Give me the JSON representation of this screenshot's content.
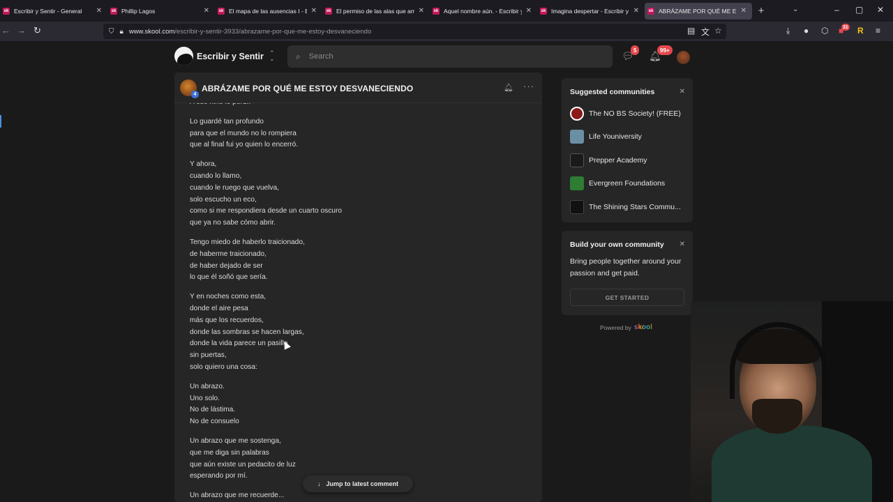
{
  "browser": {
    "tabs": [
      {
        "favicon": "sk",
        "title": "Escribir y Sentir - General",
        "active": false
      },
      {
        "favicon": "sk",
        "title": "Phillip Lagos",
        "active": false
      },
      {
        "favicon": "sk",
        "title": "El mapa de las ausencias I - Esc",
        "active": false
      },
      {
        "favicon": "sk",
        "title": "El permiso de las alas que amé",
        "active": false
      },
      {
        "favicon": "sk",
        "title": "Aquel nombre aún. - Escribir y S",
        "active": false
      },
      {
        "favicon": "sk",
        "title": "Imagina despertar - Escribir y S",
        "active": false
      },
      {
        "favicon": "sk",
        "title": "ABRÁZAME POR QUÉ ME ESTO",
        "active": true
      }
    ],
    "new_tab": "+",
    "url_host": "www.skool.com",
    "url_path": "/escribir-y-sentir-3933/abrazame-por-que-me-estoy-desvaneciendo",
    "extension_badge": "31"
  },
  "app": {
    "community_name": "Escribir y Sentir",
    "search_placeholder": "Search",
    "chat_badge": "5",
    "notif_badge": "99+"
  },
  "post": {
    "author_level": "4",
    "title": "ABRÁZAME POR QUÉ ME ESTOY DESVANECIENDO",
    "stanzas": [
      [
        "A ese niño lo perdí."
      ],
      [
        "Lo guardé tan profundo",
        "para que el mundo no lo rompiera",
        "que al final fui yo quien lo encerró."
      ],
      [
        "Y ahora,",
        "cuando lo llamo,",
        "cuando le ruego que vuelva,",
        "solo escucho un eco,",
        "como si me respondiera desde un cuarto oscuro",
        "que ya no sabe cómo abrir."
      ],
      [
        "Tengo miedo de haberlo traicionado,",
        "de haberme traicionado,",
        "de haber dejado de ser",
        "lo que él soñó que sería."
      ],
      [
        "Y en noches como esta,",
        "donde el aire pesa",
        "más que los recuerdos,",
        "donde las sombras se hacen largas,",
        "donde la vida parece un pasillo",
        "sin puertas,",
        "solo quiero una cosa:"
      ],
      [
        "Un abrazo.",
        "Uno solo.",
        "No de lástima.",
        "No de consuelo"
      ],
      [
        "Un abrazo que me sostenga,",
        "que me diga sin palabras",
        "que aún existe un pedacito de luz",
        "esperando por mí."
      ],
      [
        "Un abrazo que me recuerde..."
      ]
    ],
    "jump_label": "Jump to latest comment"
  },
  "sidebar": {
    "suggested_title": "Suggested communities",
    "communities": [
      {
        "name": "The NO BS Society! (FREE)",
        "color": "#8b1a1a"
      },
      {
        "name": "Life Youniversity",
        "color": "#6a8fa3"
      },
      {
        "name": "Prepper Academy",
        "color": "#1a1a1a"
      },
      {
        "name": "Evergreen Foundations",
        "color": "#2e7d32"
      },
      {
        "name": "The Shining Stars Commu...",
        "color": "#111111"
      }
    ],
    "build_title": "Build your own community",
    "build_text": "Bring people together around your passion and get paid.",
    "build_button": "GET STARTED",
    "powered_by": "Powered by",
    "powered_brand": "skool"
  }
}
